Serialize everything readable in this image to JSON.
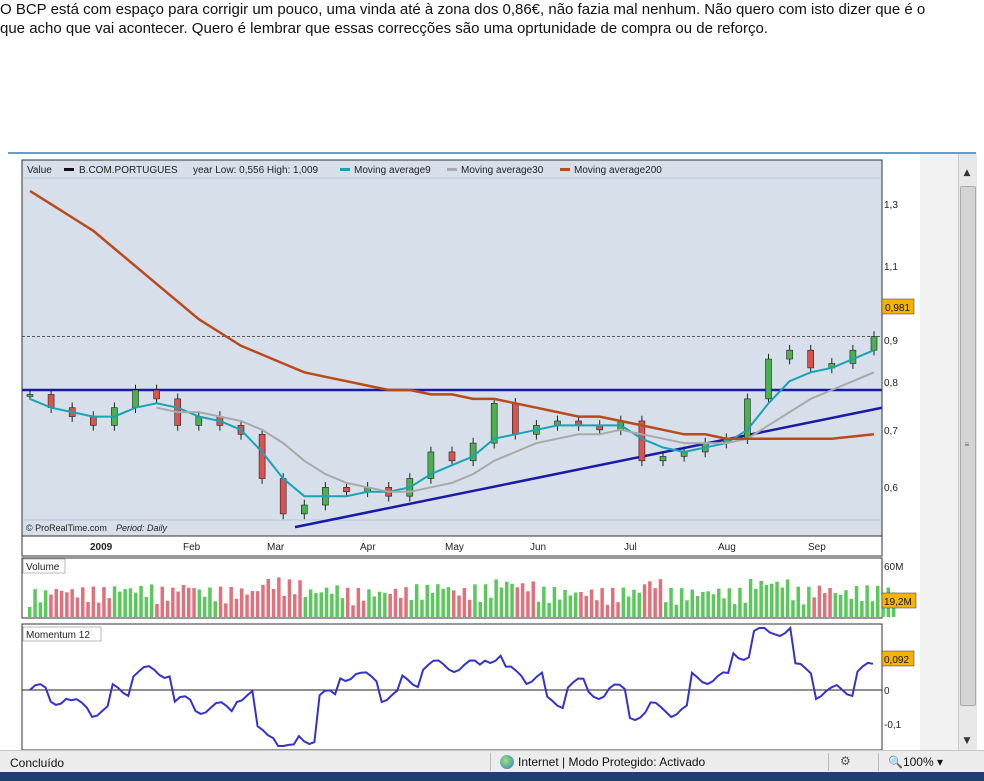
{
  "article": {
    "line1": "O BCP está com espaço para corrigir um pouco, uma vinda até à zona dos 0,86€, não fazia mal nenhum. Não quero com isto dizer que é o",
    "line2": "que acho que vai acontecer. Quero é lembrar que essas correcções são uma oprtunidade de compra ou de reforço."
  },
  "chart_header": {
    "value_label": "Value",
    "symbol": "B.COM.PORTUGUES",
    "year_range": "year Low: 0,556 High: 1,009",
    "ma9": "Moving average9",
    "ma30": "Moving average30",
    "ma200": "Moving average200",
    "credit": "© ProRealTime.com",
    "period": "Period: Daily"
  },
  "price_axis": [
    "1,3",
    "1,1",
    "0,9",
    "0,8",
    "0,7",
    "0,6"
  ],
  "last_price_tag": "0,981",
  "x_axis": [
    "2009",
    "Feb",
    "Mar",
    "Apr",
    "May",
    "Jun",
    "Jul",
    "Aug",
    "Sep"
  ],
  "volume_panel": {
    "title": "Volume",
    "axis_top": "60M",
    "last_tag": "19,2M"
  },
  "momentum_panel": {
    "title": "Momentum 12",
    "axis": [
      "0",
      "-0,1"
    ],
    "last_tag": "0,092"
  },
  "colors": {
    "price_bg": "#d6dfea",
    "ma9": "#19a3b5",
    "ma30": "#a9a9a9",
    "ma200": "#b84a1b",
    "trendline": "#1a1aa8",
    "up": "#4caf50",
    "down": "#d9534f",
    "momentum": "#3333cc",
    "tag": "#f5b400"
  },
  "chart_data": {
    "type": "line",
    "title": "B.COM.PORTUGUES",
    "series": [
      {
        "name": "B.COM.PORTUGUES",
        "values": [
          0.85,
          0.82,
          0.8,
          0.78,
          0.82,
          0.86,
          0.84,
          0.78,
          0.8,
          0.78,
          0.76,
          0.66,
          0.58,
          0.6,
          0.64,
          0.63,
          0.64,
          0.62,
          0.66,
          0.72,
          0.7,
          0.74,
          0.83,
          0.76,
          0.78,
          0.79,
          0.78,
          0.77,
          0.79,
          0.7,
          0.71,
          0.72,
          0.74,
          0.75,
          0.84,
          0.93,
          0.95,
          0.91,
          0.92,
          0.95,
          0.981
        ]
      },
      {
        "name": "Moving average9",
        "values": [
          0.84,
          0.82,
          0.81,
          0.8,
          0.8,
          0.82,
          0.83,
          0.82,
          0.8,
          0.79,
          0.77,
          0.72,
          0.66,
          0.62,
          0.62,
          0.62,
          0.63,
          0.63,
          0.64,
          0.67,
          0.69,
          0.71,
          0.75,
          0.76,
          0.77,
          0.78,
          0.78,
          0.78,
          0.78,
          0.75,
          0.73,
          0.72,
          0.73,
          0.74,
          0.77,
          0.83,
          0.88,
          0.9,
          0.91,
          0.93,
          0.95
        ]
      },
      {
        "name": "Moving average30",
        "values": [
          null,
          null,
          null,
          null,
          null,
          null,
          0.82,
          0.81,
          0.81,
          0.8,
          0.79,
          0.77,
          0.74,
          0.7,
          0.67,
          0.65,
          0.64,
          0.63,
          0.63,
          0.64,
          0.65,
          0.67,
          0.7,
          0.72,
          0.74,
          0.75,
          0.76,
          0.76,
          0.77,
          0.76,
          0.75,
          0.74,
          0.74,
          0.74,
          0.75,
          0.78,
          0.81,
          0.84,
          0.86,
          0.88,
          0.9
        ]
      },
      {
        "name": "Moving average200",
        "values": [
          1.31,
          1.28,
          1.25,
          1.22,
          1.18,
          1.14,
          1.1,
          1.06,
          1.02,
          0.99,
          0.96,
          0.94,
          0.92,
          0.9,
          0.89,
          0.88,
          0.87,
          0.86,
          0.86,
          0.85,
          0.85,
          0.84,
          0.84,
          0.83,
          0.82,
          0.81,
          0.8,
          0.8,
          0.79,
          0.78,
          0.77,
          0.76,
          0.76,
          0.75,
          0.75,
          0.75,
          0.75,
          0.75,
          0.75,
          0.755,
          0.76
        ]
      }
    ],
    "horizontal_line": 0.86,
    "support_trendline": [
      [
        0.55,
        0.55
      ],
      [
        1.0,
        0.82
      ]
    ],
    "ylim": [
      0.53,
      1.38
    ],
    "xlabel": "",
    "ylabel": ""
  },
  "status": {
    "done": "Concluído",
    "zone": "Internet | Modo Protegido: Activado",
    "zoom": "100%"
  }
}
